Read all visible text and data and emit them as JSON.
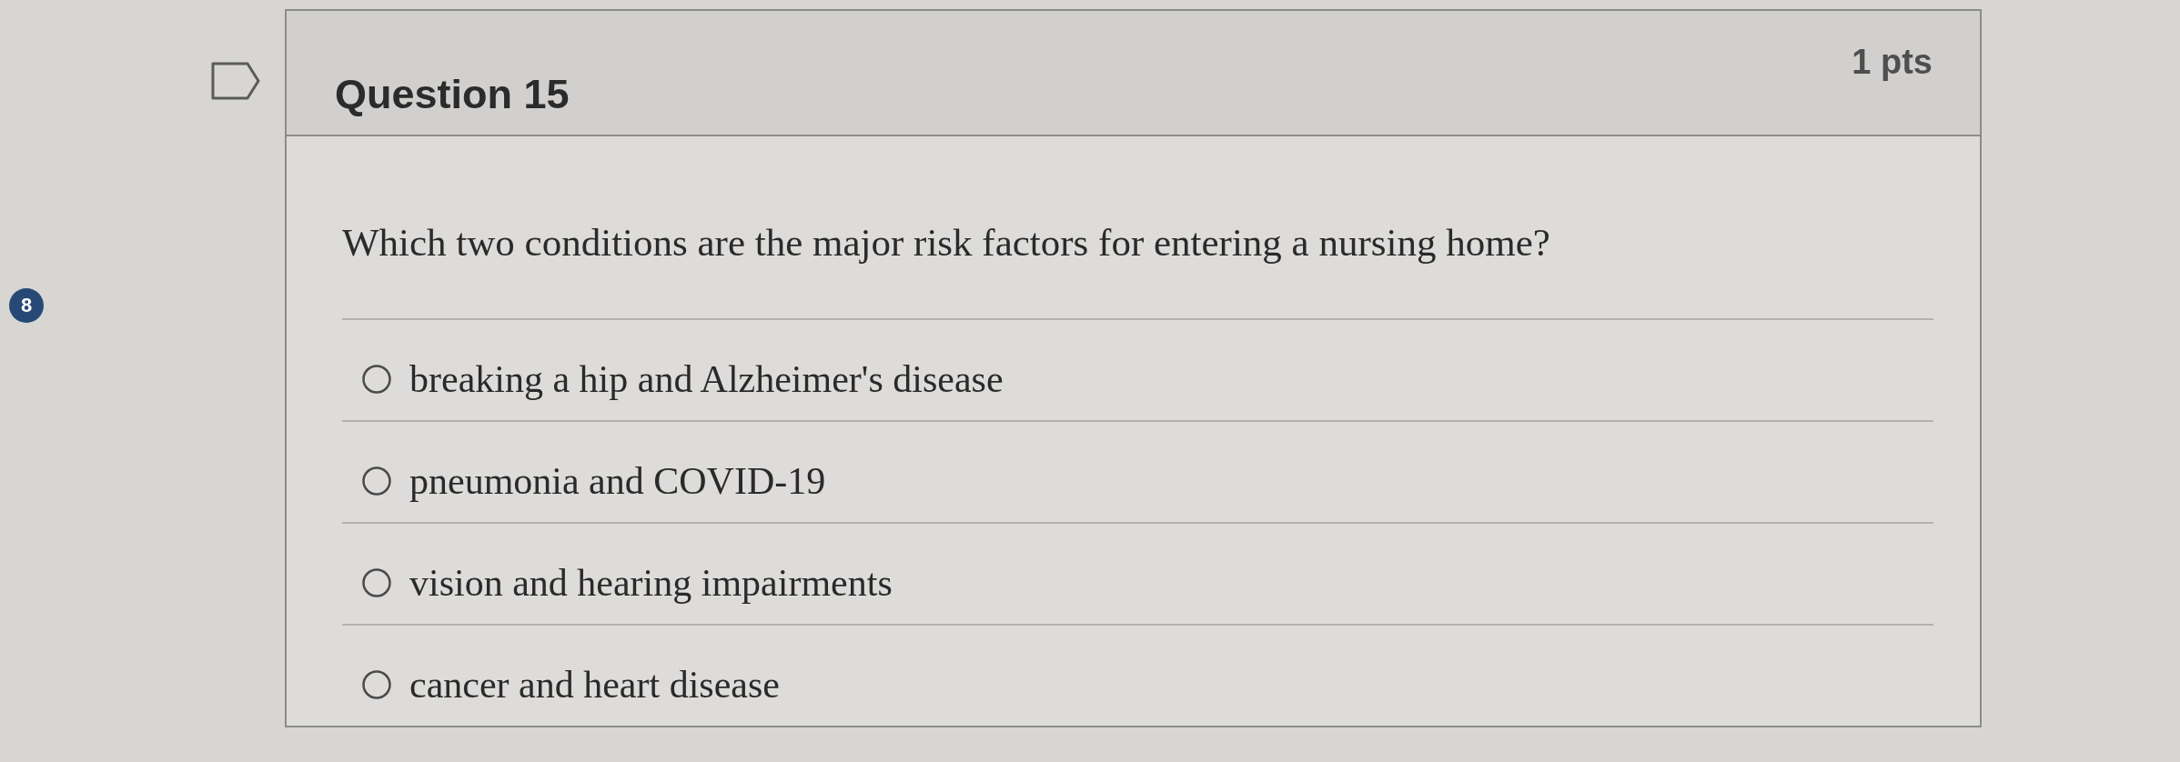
{
  "side_badge": "8",
  "question": {
    "title": "Question 15",
    "points": "1 pts",
    "text": "Which two conditions are the major risk factors for entering a nursing home?",
    "answers": [
      {
        "label": "breaking a hip and Alzheimer's disease",
        "selected": false
      },
      {
        "label": "pneumonia and COVID-19",
        "selected": false
      },
      {
        "label": "vision and hearing impairments",
        "selected": false
      },
      {
        "label": "cancer and heart disease",
        "selected": false
      }
    ]
  }
}
